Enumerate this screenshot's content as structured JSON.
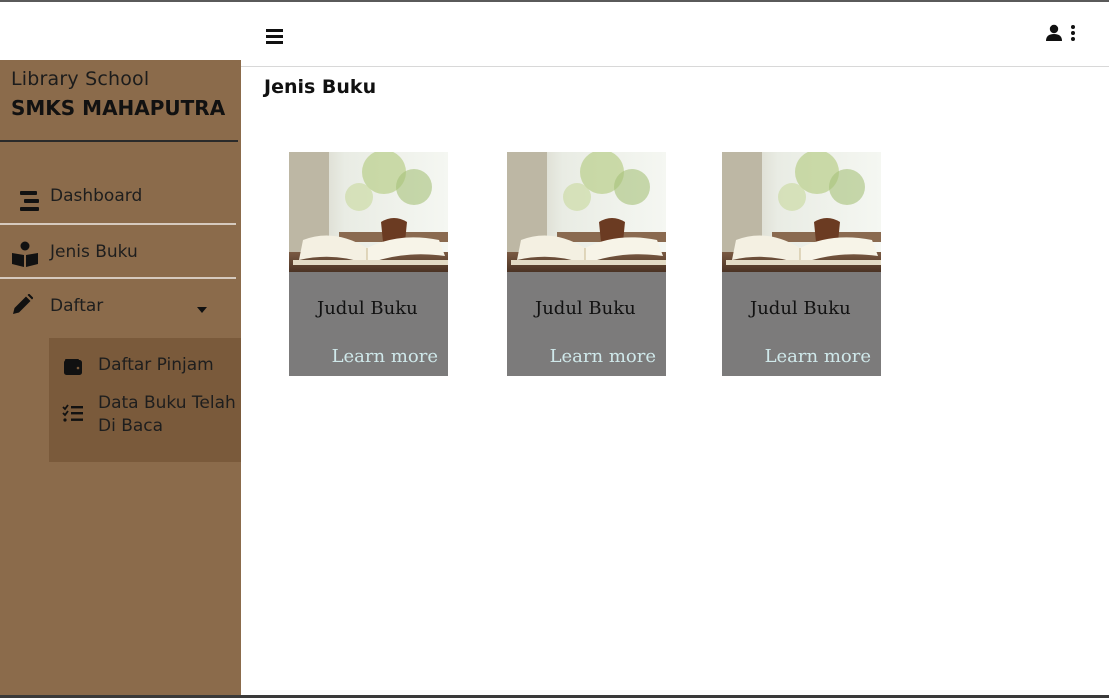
{
  "sidebar": {
    "brand_top": "Library School",
    "brand_main": "SMKS MAHAPUTRA",
    "items": [
      {
        "label": "Dashboard",
        "icon": "dashboard-icon"
      },
      {
        "label": "Jenis Buku",
        "icon": "book-reader-icon"
      },
      {
        "label": "Daftar",
        "icon": "pencil-icon",
        "expanded": true
      }
    ],
    "submenu": [
      {
        "label": "Daftar Pinjam",
        "icon": "wallet-icon"
      },
      {
        "label": "Data Buku Telah Di Baca",
        "icon": "list-check-icon"
      }
    ]
  },
  "main": {
    "title": "Jenis Buku",
    "cards": [
      {
        "title": "Judul Buku",
        "link": "Learn more"
      },
      {
        "title": "Judul Buku",
        "link": "Learn more"
      },
      {
        "title": "Judul Buku",
        "link": "Learn more"
      }
    ]
  },
  "colors": {
    "sidebar": "#8b6b4b",
    "submenu": "#7a5a3b",
    "card": "#7c7b7b",
    "link": "#cfe8ea"
  }
}
